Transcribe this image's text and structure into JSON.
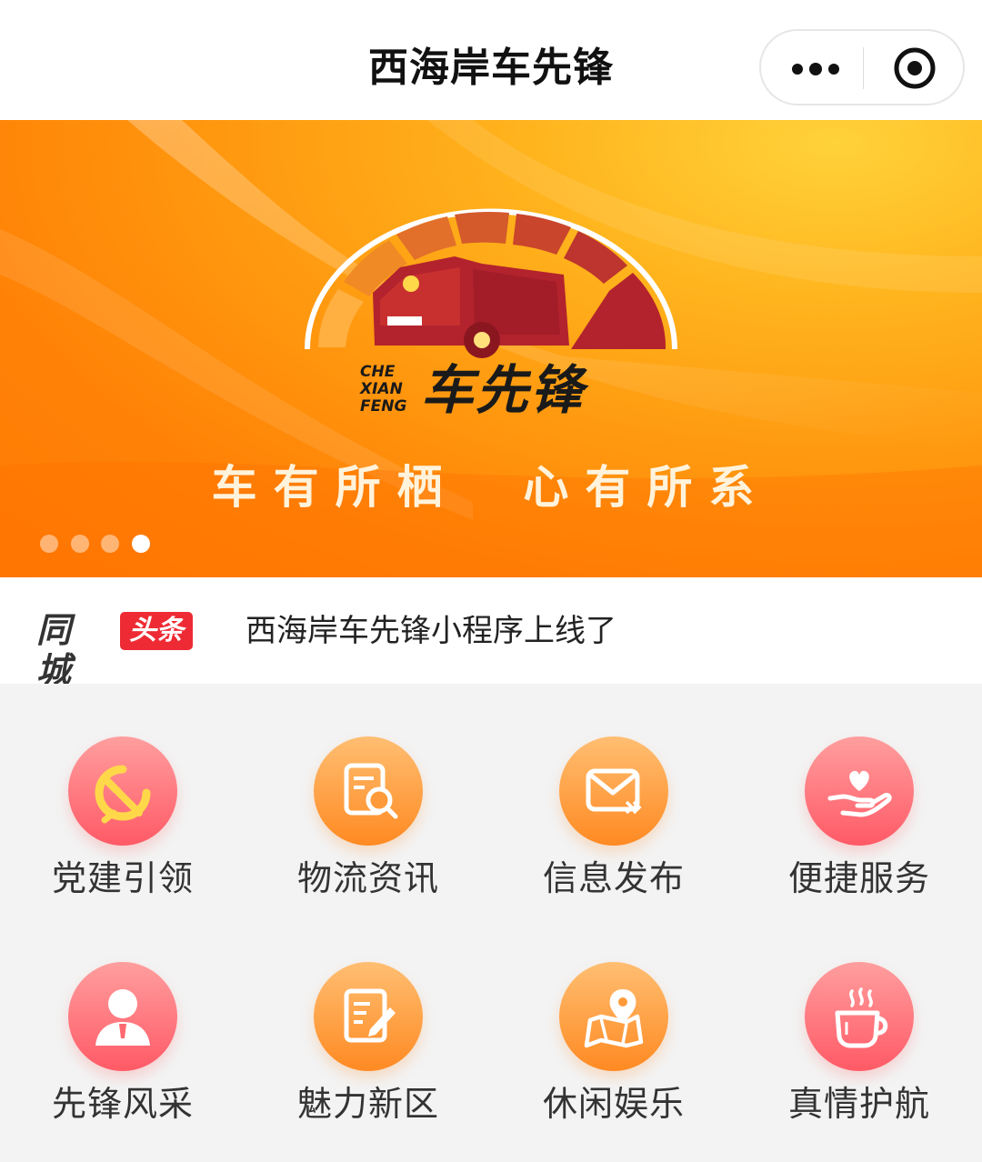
{
  "header": {
    "title": "西海岸车先锋",
    "capsule": {
      "more_icon": "more-dots-icon",
      "close_icon": "target-close-icon"
    }
  },
  "banner": {
    "brand_pinyin": [
      "CHE",
      "XIAN",
      "FENG"
    ],
    "brand_name": "车先锋",
    "slogan": "车有所栖  心有所系",
    "dots": {
      "count": 4,
      "active_index": 3
    },
    "colors": {
      "orange": "#ff7a04",
      "yellow": "#ffd23a",
      "logo_red": "#b3232d"
    }
  },
  "news": {
    "brand_city": "同城",
    "brand_tag": "头条",
    "headline": "西海岸车先锋小程序上线了"
  },
  "grid": {
    "items": [
      {
        "label": "党建引领",
        "icon": "hammer-sickle-icon",
        "color": "pink"
      },
      {
        "label": "物流资讯",
        "icon": "document-search-icon",
        "color": "orange"
      },
      {
        "label": "信息发布",
        "icon": "envelope-send-icon",
        "color": "orange"
      },
      {
        "label": "便捷服务",
        "icon": "heart-hand-icon",
        "color": "pink"
      },
      {
        "label": "先锋风采",
        "icon": "person-avatar-icon",
        "color": "pink"
      },
      {
        "label": "魅力新区",
        "icon": "document-edit-icon",
        "color": "orange"
      },
      {
        "label": "休闲娱乐",
        "icon": "map-pin-icon",
        "color": "orange"
      },
      {
        "label": "真情护航",
        "icon": "coffee-cup-icon",
        "color": "pink"
      }
    ]
  }
}
